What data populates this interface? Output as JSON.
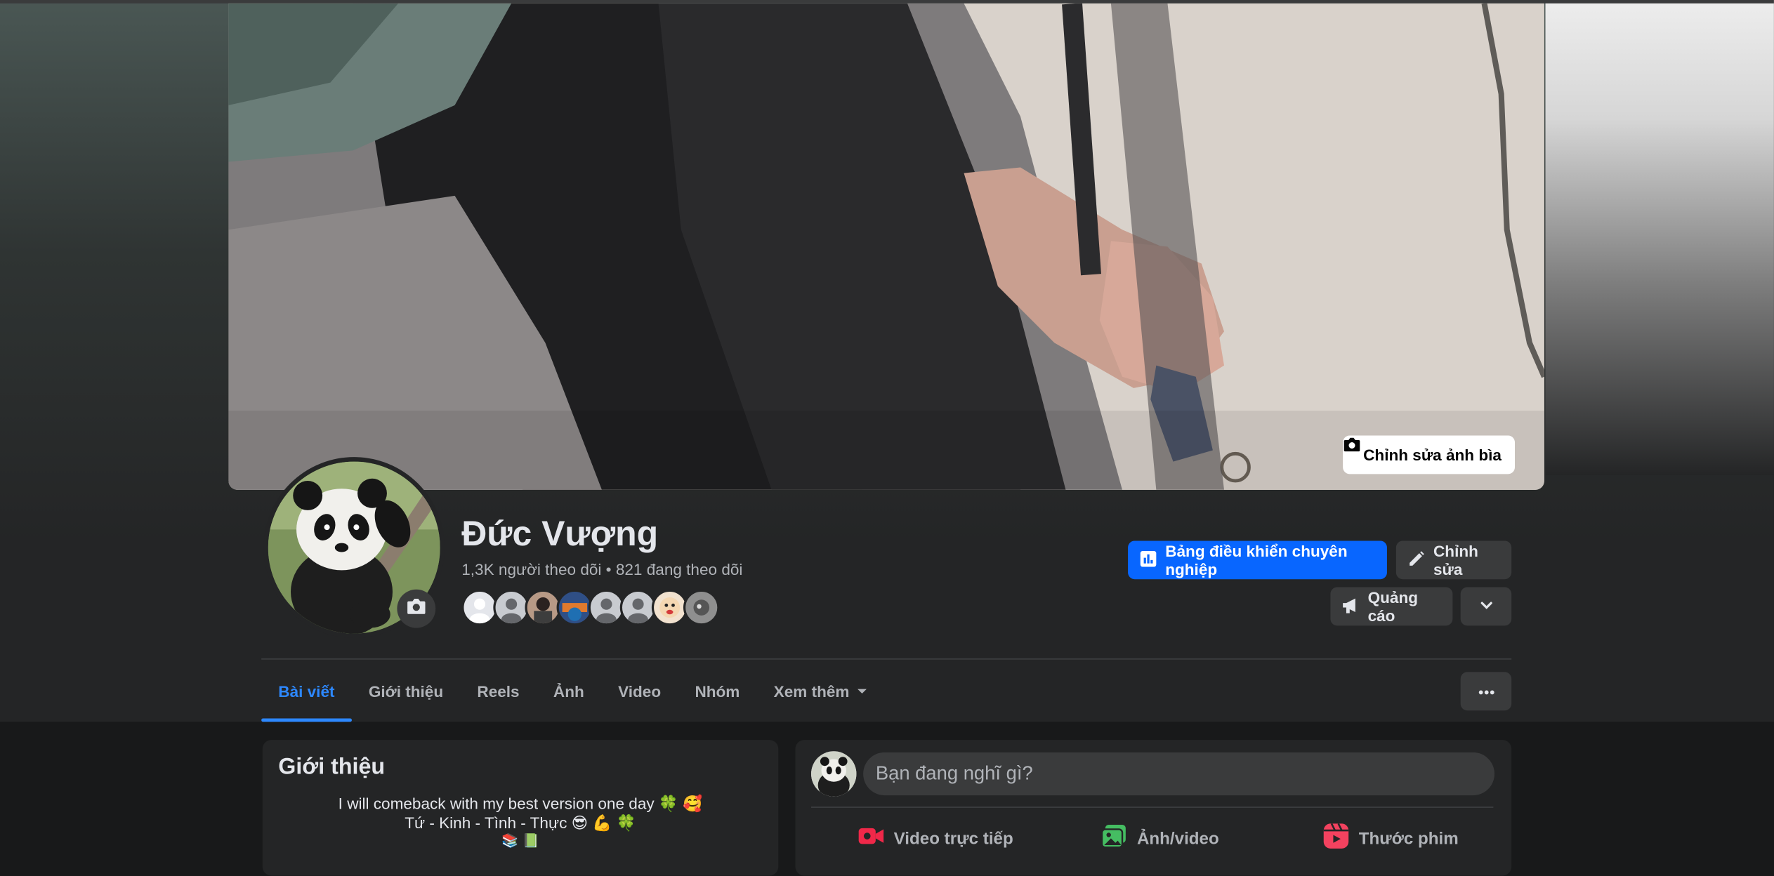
{
  "cover": {
    "edit_label": "Chỉnh sửa ảnh bìa"
  },
  "profile": {
    "name": "Đức Vượng",
    "stats": "1,3K người theo dõi • 821 đang theo dõi"
  },
  "actions": {
    "dashboard_label": "Bảng điều khiển chuyên nghiệp",
    "edit_label": "Chỉnh sửa",
    "ads_label": "Quảng cáo"
  },
  "tabs": [
    {
      "label": "Bài viết",
      "active": true
    },
    {
      "label": "Giới thiệu",
      "active": false
    },
    {
      "label": "Reels",
      "active": false
    },
    {
      "label": "Ảnh",
      "active": false
    },
    {
      "label": "Video",
      "active": false
    },
    {
      "label": "Nhóm",
      "active": false
    },
    {
      "label": "Xem thêm",
      "active": false
    }
  ],
  "intro": {
    "title": "Giới thiệu",
    "bio_line1": "I will comeback with my best version one day 🍀 🥰",
    "bio_line2": "Tứ - Kinh - Tình - Thực 😎 💪 🍀",
    "bio_line3": "📚 📗"
  },
  "composer": {
    "placeholder": "Bạn đang nghĩ gì?",
    "live_label": "Video trực tiếp",
    "photo_label": "Ảnh/video",
    "reel_label": "Thước phim"
  },
  "colors": {
    "accent": "#2d88ff",
    "primary_button": "#0866ff",
    "background": "#18191a",
    "surface": "#242526"
  }
}
